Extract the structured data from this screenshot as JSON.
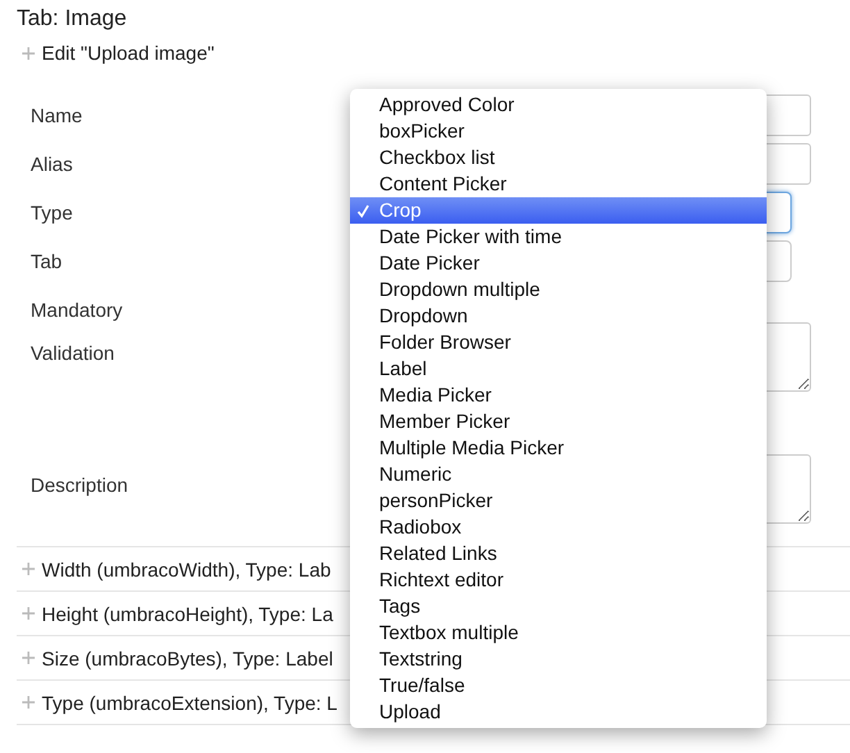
{
  "title": "Tab: Image",
  "edit_header": {
    "label": "Edit \"Upload image\"",
    "expanded": true
  },
  "fields": [
    {
      "label": "Name",
      "kind": "input"
    },
    {
      "label": "Alias",
      "kind": "input"
    },
    {
      "label": "Type",
      "kind": "select",
      "focused": true
    },
    {
      "label": "Tab",
      "kind": "select",
      "focused": false
    },
    {
      "label": "Mandatory",
      "kind": "none"
    },
    {
      "label": "Validation",
      "kind": "textarea"
    },
    {
      "label": "Description",
      "kind": "textarea"
    }
  ],
  "properties": [
    {
      "label": "Width (umbracoWidth), Type: Lab"
    },
    {
      "label": "Height (umbracoHeight), Type: La"
    },
    {
      "label": "Size (umbracoBytes), Type: Label"
    },
    {
      "label": "Type (umbracoExtension), Type: L"
    }
  ],
  "type_menu": [
    {
      "label": "Approved Color",
      "selected": false
    },
    {
      "label": "boxPicker",
      "selected": false
    },
    {
      "label": "Checkbox list",
      "selected": false
    },
    {
      "label": "Content Picker",
      "selected": false
    },
    {
      "label": "Crop",
      "selected": true
    },
    {
      "label": "Date Picker with time",
      "selected": false
    },
    {
      "label": "Date Picker",
      "selected": false
    },
    {
      "label": "Dropdown multiple",
      "selected": false
    },
    {
      "label": "Dropdown",
      "selected": false
    },
    {
      "label": "Folder Browser",
      "selected": false
    },
    {
      "label": "Label",
      "selected": false
    },
    {
      "label": "Media Picker",
      "selected": false
    },
    {
      "label": "Member Picker",
      "selected": false
    },
    {
      "label": "Multiple Media Picker",
      "selected": false
    },
    {
      "label": "Numeric",
      "selected": false
    },
    {
      "label": "personPicker",
      "selected": false
    },
    {
      "label": "Radiobox",
      "selected": false
    },
    {
      "label": "Related Links",
      "selected": false
    },
    {
      "label": "Richtext editor",
      "selected": false
    },
    {
      "label": "Tags",
      "selected": false
    },
    {
      "label": "Textbox multiple",
      "selected": false
    },
    {
      "label": "Textstring",
      "selected": false
    },
    {
      "label": "True/false",
      "selected": false
    },
    {
      "label": "Upload",
      "selected": false
    }
  ]
}
